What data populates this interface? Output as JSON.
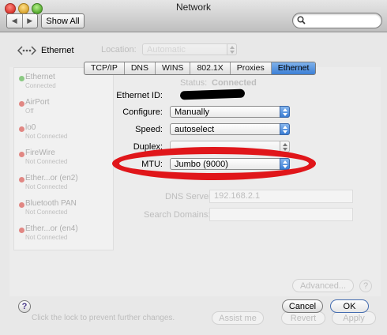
{
  "window": {
    "title": "Network"
  },
  "toolbar": {
    "show_all": "Show All",
    "back_icon": "◀",
    "forward_icon": "▶",
    "search_placeholder": ""
  },
  "header": {
    "title": "Ethernet"
  },
  "tabs": [
    {
      "label": "TCP/IP",
      "active": false
    },
    {
      "label": "DNS",
      "active": false
    },
    {
      "label": "WINS",
      "active": false
    },
    {
      "label": "802.1X",
      "active": false
    },
    {
      "label": "Proxies",
      "active": false
    },
    {
      "label": "Ethernet",
      "active": true
    }
  ],
  "form": {
    "ethernet_id_label": "Ethernet ID:",
    "configure_label": "Configure:",
    "configure_value": "Manually",
    "speed_label": "Speed:",
    "speed_value": "autoselect",
    "duplex_label": "Duplex:",
    "duplex_value": "",
    "mtu_label": "MTU:",
    "mtu_value": "Jumbo  (9000)"
  },
  "background": {
    "location_label": "Location:",
    "location_value": "Automatic",
    "status_label": "Status:",
    "status_value": "Connected",
    "dns_server_label": "DNS Server:",
    "dns_server_value": "192.168.2.1",
    "search_domains_label": "Search Domains:",
    "advanced_label": "Advanced...",
    "lock_text": "Click the lock to prevent further changes.",
    "assist_label": "Assist me",
    "revert_label": "Revert",
    "apply_label": "Apply",
    "sidebar": [
      {
        "name": "Ethernet",
        "sub": "Connected",
        "color": "#3cae2f"
      },
      {
        "name": "AirPort",
        "sub": "Off",
        "color": "#d9352e"
      },
      {
        "name": "lo0",
        "sub": "Not Connected",
        "color": "#d9352e"
      },
      {
        "name": "FireWire",
        "sub": "Not Connected",
        "color": "#d9352e"
      },
      {
        "name": "Ether...or (en2)",
        "sub": "Not Connected",
        "color": "#d9352e"
      },
      {
        "name": "Bluetooth PAN",
        "sub": "Not Connected",
        "color": "#d9352e"
      },
      {
        "name": "Ether...or (en4)",
        "sub": "Not Connected",
        "color": "#d9352e"
      }
    ]
  },
  "buttons": {
    "cancel": "Cancel",
    "ok": "OK",
    "help": "?"
  },
  "colors": {
    "accent": "#3c7fd6",
    "annotation_ring": "#e0161a"
  }
}
